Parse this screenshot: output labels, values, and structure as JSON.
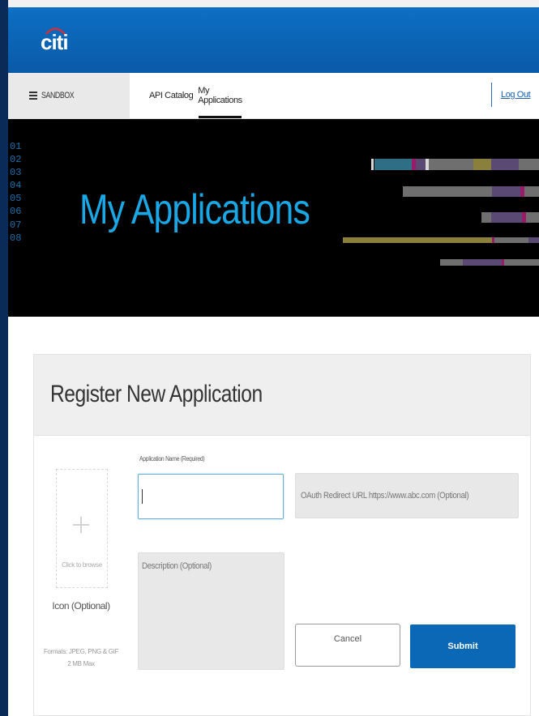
{
  "brand": {
    "logo_text": "citi"
  },
  "nav": {
    "sandbox_label": "SANDBOX",
    "tabs": [
      {
        "label": "API Catalog",
        "active": false
      },
      {
        "label": "My Applications",
        "active": true
      }
    ],
    "logout_label": "Log Out"
  },
  "banner": {
    "title": "My Applications",
    "line_numbers": [
      "01",
      "02",
      "03",
      "04",
      "05",
      "06",
      "07",
      "08"
    ]
  },
  "form": {
    "title": "Register New Application",
    "icon_upload": {
      "browse_text": "Click to browse",
      "label": "Icon (Optional)",
      "formats_line1": "Formats: JPEG, PNG & GIF",
      "formats_line2": "2 MB Max"
    },
    "app_name_label": "Application Name (Required)",
    "app_name_value": "",
    "oauth_placeholder": "OAuth Redirect URL https://www.abc.com (Optional)",
    "description_placeholder": "Description (Optional)",
    "cancel_label": "Cancel",
    "submit_label": "Submit"
  },
  "colors": {
    "header_blue": "#0d6fc4",
    "banner_title": "#1aa7e6",
    "submit_blue": "#0a68b7",
    "link_blue": "#1a5fb0"
  }
}
